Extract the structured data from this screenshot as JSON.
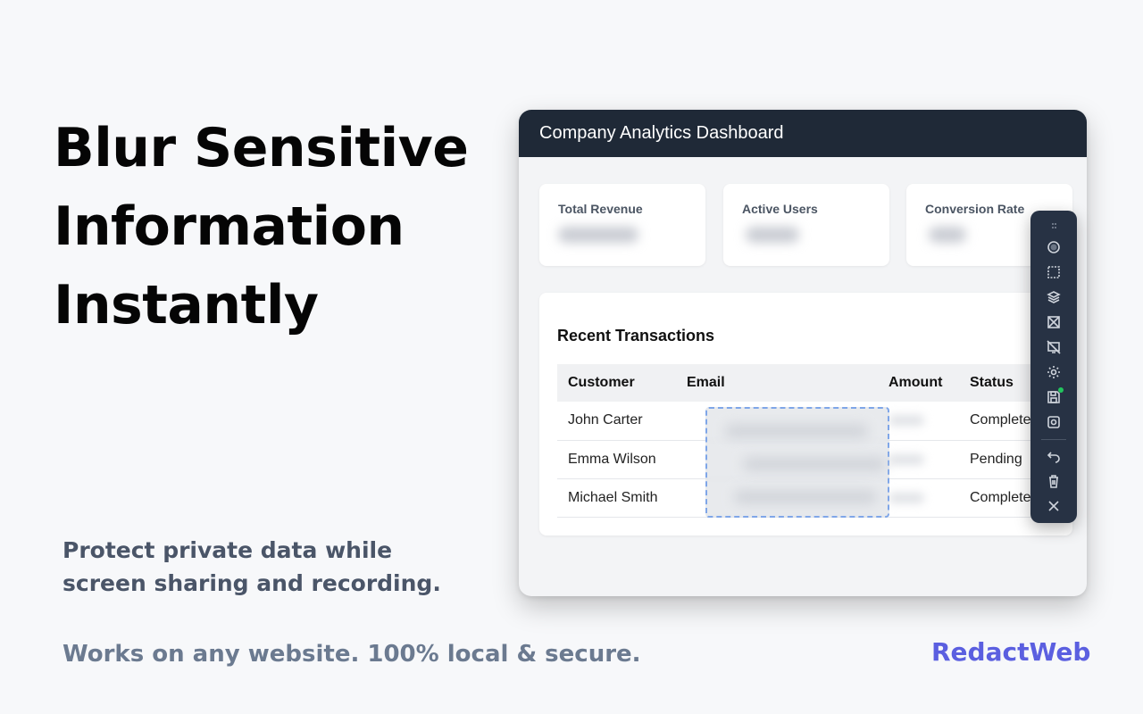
{
  "hero": {
    "headline_lines": [
      "Blur Sensitive",
      "Information",
      "Instantly"
    ],
    "subtext_lines": [
      "Protect private data while",
      "screen sharing and recording."
    ],
    "footnote": "Works on any website. 100% local & secure.",
    "brand": "RedactWeb",
    "brand_color": "#5b5fe0"
  },
  "dashboard": {
    "title": "Company Analytics Dashboard",
    "stats": [
      {
        "label": "Total Revenue"
      },
      {
        "label": "Active Users"
      },
      {
        "label": "Conversion Rate"
      }
    ],
    "transactions": {
      "title": "Recent Transactions",
      "columns": [
        "Customer",
        "Email",
        "Amount",
        "Status"
      ],
      "rows": [
        {
          "customer": "John Carter",
          "status": "Complete"
        },
        {
          "customer": "Emma Wilson",
          "status": "Pending"
        },
        {
          "customer": "Michael Smith",
          "status": "Complete"
        }
      ]
    }
  },
  "toolbar": {
    "tools": [
      {
        "name": "circle-blur-icon"
      },
      {
        "name": "select-area-icon"
      },
      {
        "name": "layers-icon"
      },
      {
        "name": "redact-box-icon"
      },
      {
        "name": "hide-screen-icon"
      },
      {
        "name": "settings-icon"
      },
      {
        "name": "save-icon"
      },
      {
        "name": "capture-icon"
      },
      {
        "name": "undo-icon"
      },
      {
        "name": "delete-icon"
      },
      {
        "name": "close-icon"
      }
    ],
    "accent": "#22c55e"
  }
}
